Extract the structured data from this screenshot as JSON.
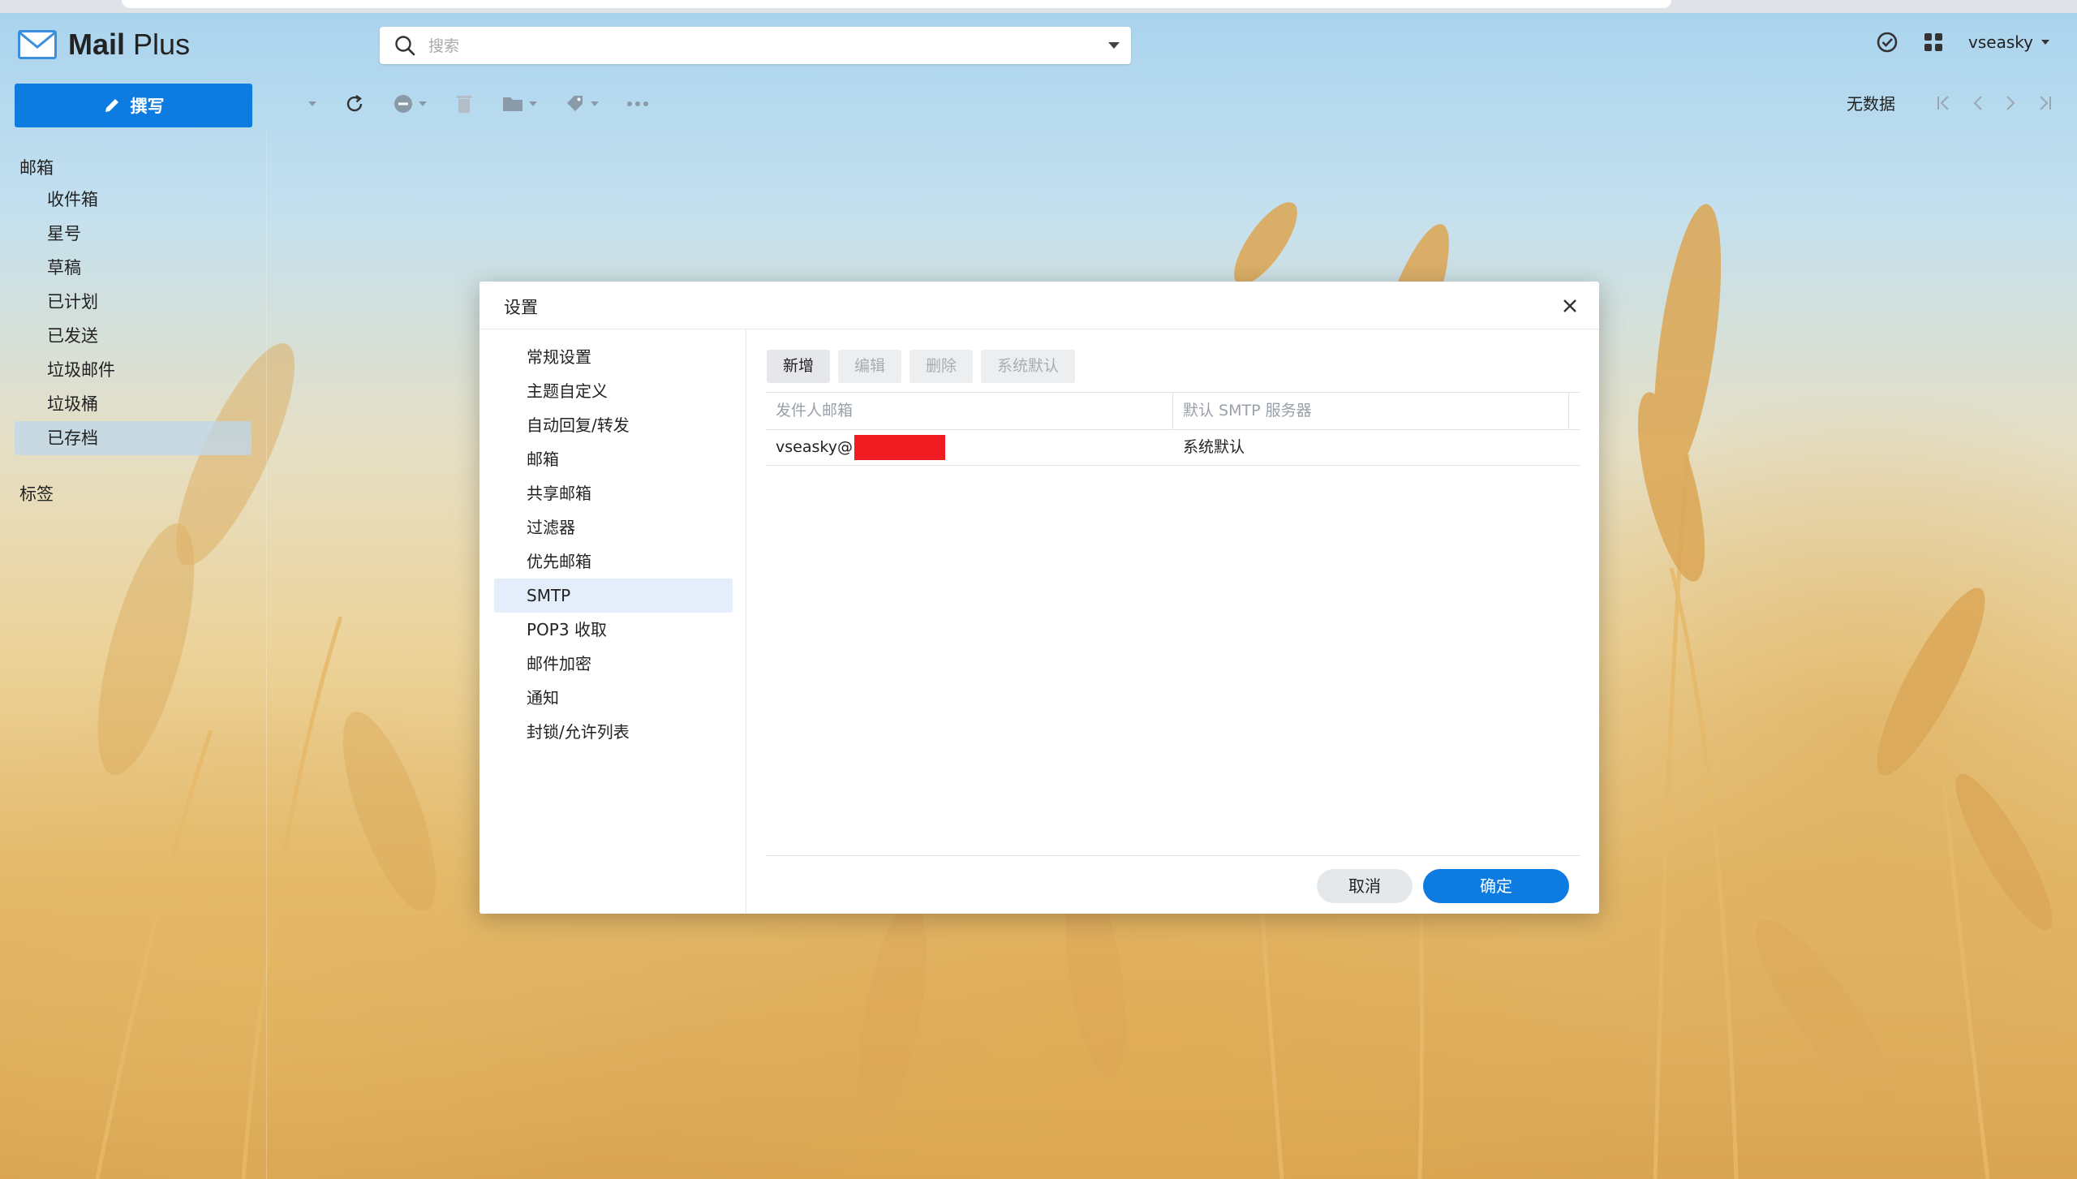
{
  "app": {
    "name_bold": "Mail",
    "name_light": "Plus"
  },
  "search": {
    "placeholder": "搜索",
    "value": ""
  },
  "header": {
    "username": "vseasky"
  },
  "compose": {
    "label": "撰写"
  },
  "toolbar": {
    "status": "无数据"
  },
  "sidebar": {
    "mailbox_header": "邮箱",
    "items": [
      {
        "label": "收件箱"
      },
      {
        "label": "星号"
      },
      {
        "label": "草稿"
      },
      {
        "label": "已计划"
      },
      {
        "label": "已发送"
      },
      {
        "label": "垃圾邮件"
      },
      {
        "label": "垃圾桶"
      },
      {
        "label": "已存档",
        "active": true
      }
    ],
    "labels_header": "标签"
  },
  "dialog": {
    "title": "设置",
    "nav": [
      {
        "label": "常规设置"
      },
      {
        "label": "主题自定义"
      },
      {
        "label": "自动回复/转发"
      },
      {
        "label": "邮箱"
      },
      {
        "label": "共享邮箱"
      },
      {
        "label": "过滤器"
      },
      {
        "label": "优先邮箱"
      },
      {
        "label": "SMTP",
        "active": true
      },
      {
        "label": "POP3 收取"
      },
      {
        "label": "邮件加密"
      },
      {
        "label": "通知"
      },
      {
        "label": "封锁/允许列表"
      }
    ],
    "buttons": {
      "add": "新增",
      "edit": "编辑",
      "delete": "删除",
      "system_default": "系统默认"
    },
    "table": {
      "columns": [
        "发件人邮箱",
        "默认 SMTP 服务器"
      ],
      "rows": [
        {
          "sender": "vseasky@",
          "server": "系统默认"
        }
      ]
    },
    "cancel": "取消",
    "ok": "确定"
  },
  "colors": {
    "accent": "#0d7be0",
    "redaction": "#ef1c22"
  }
}
